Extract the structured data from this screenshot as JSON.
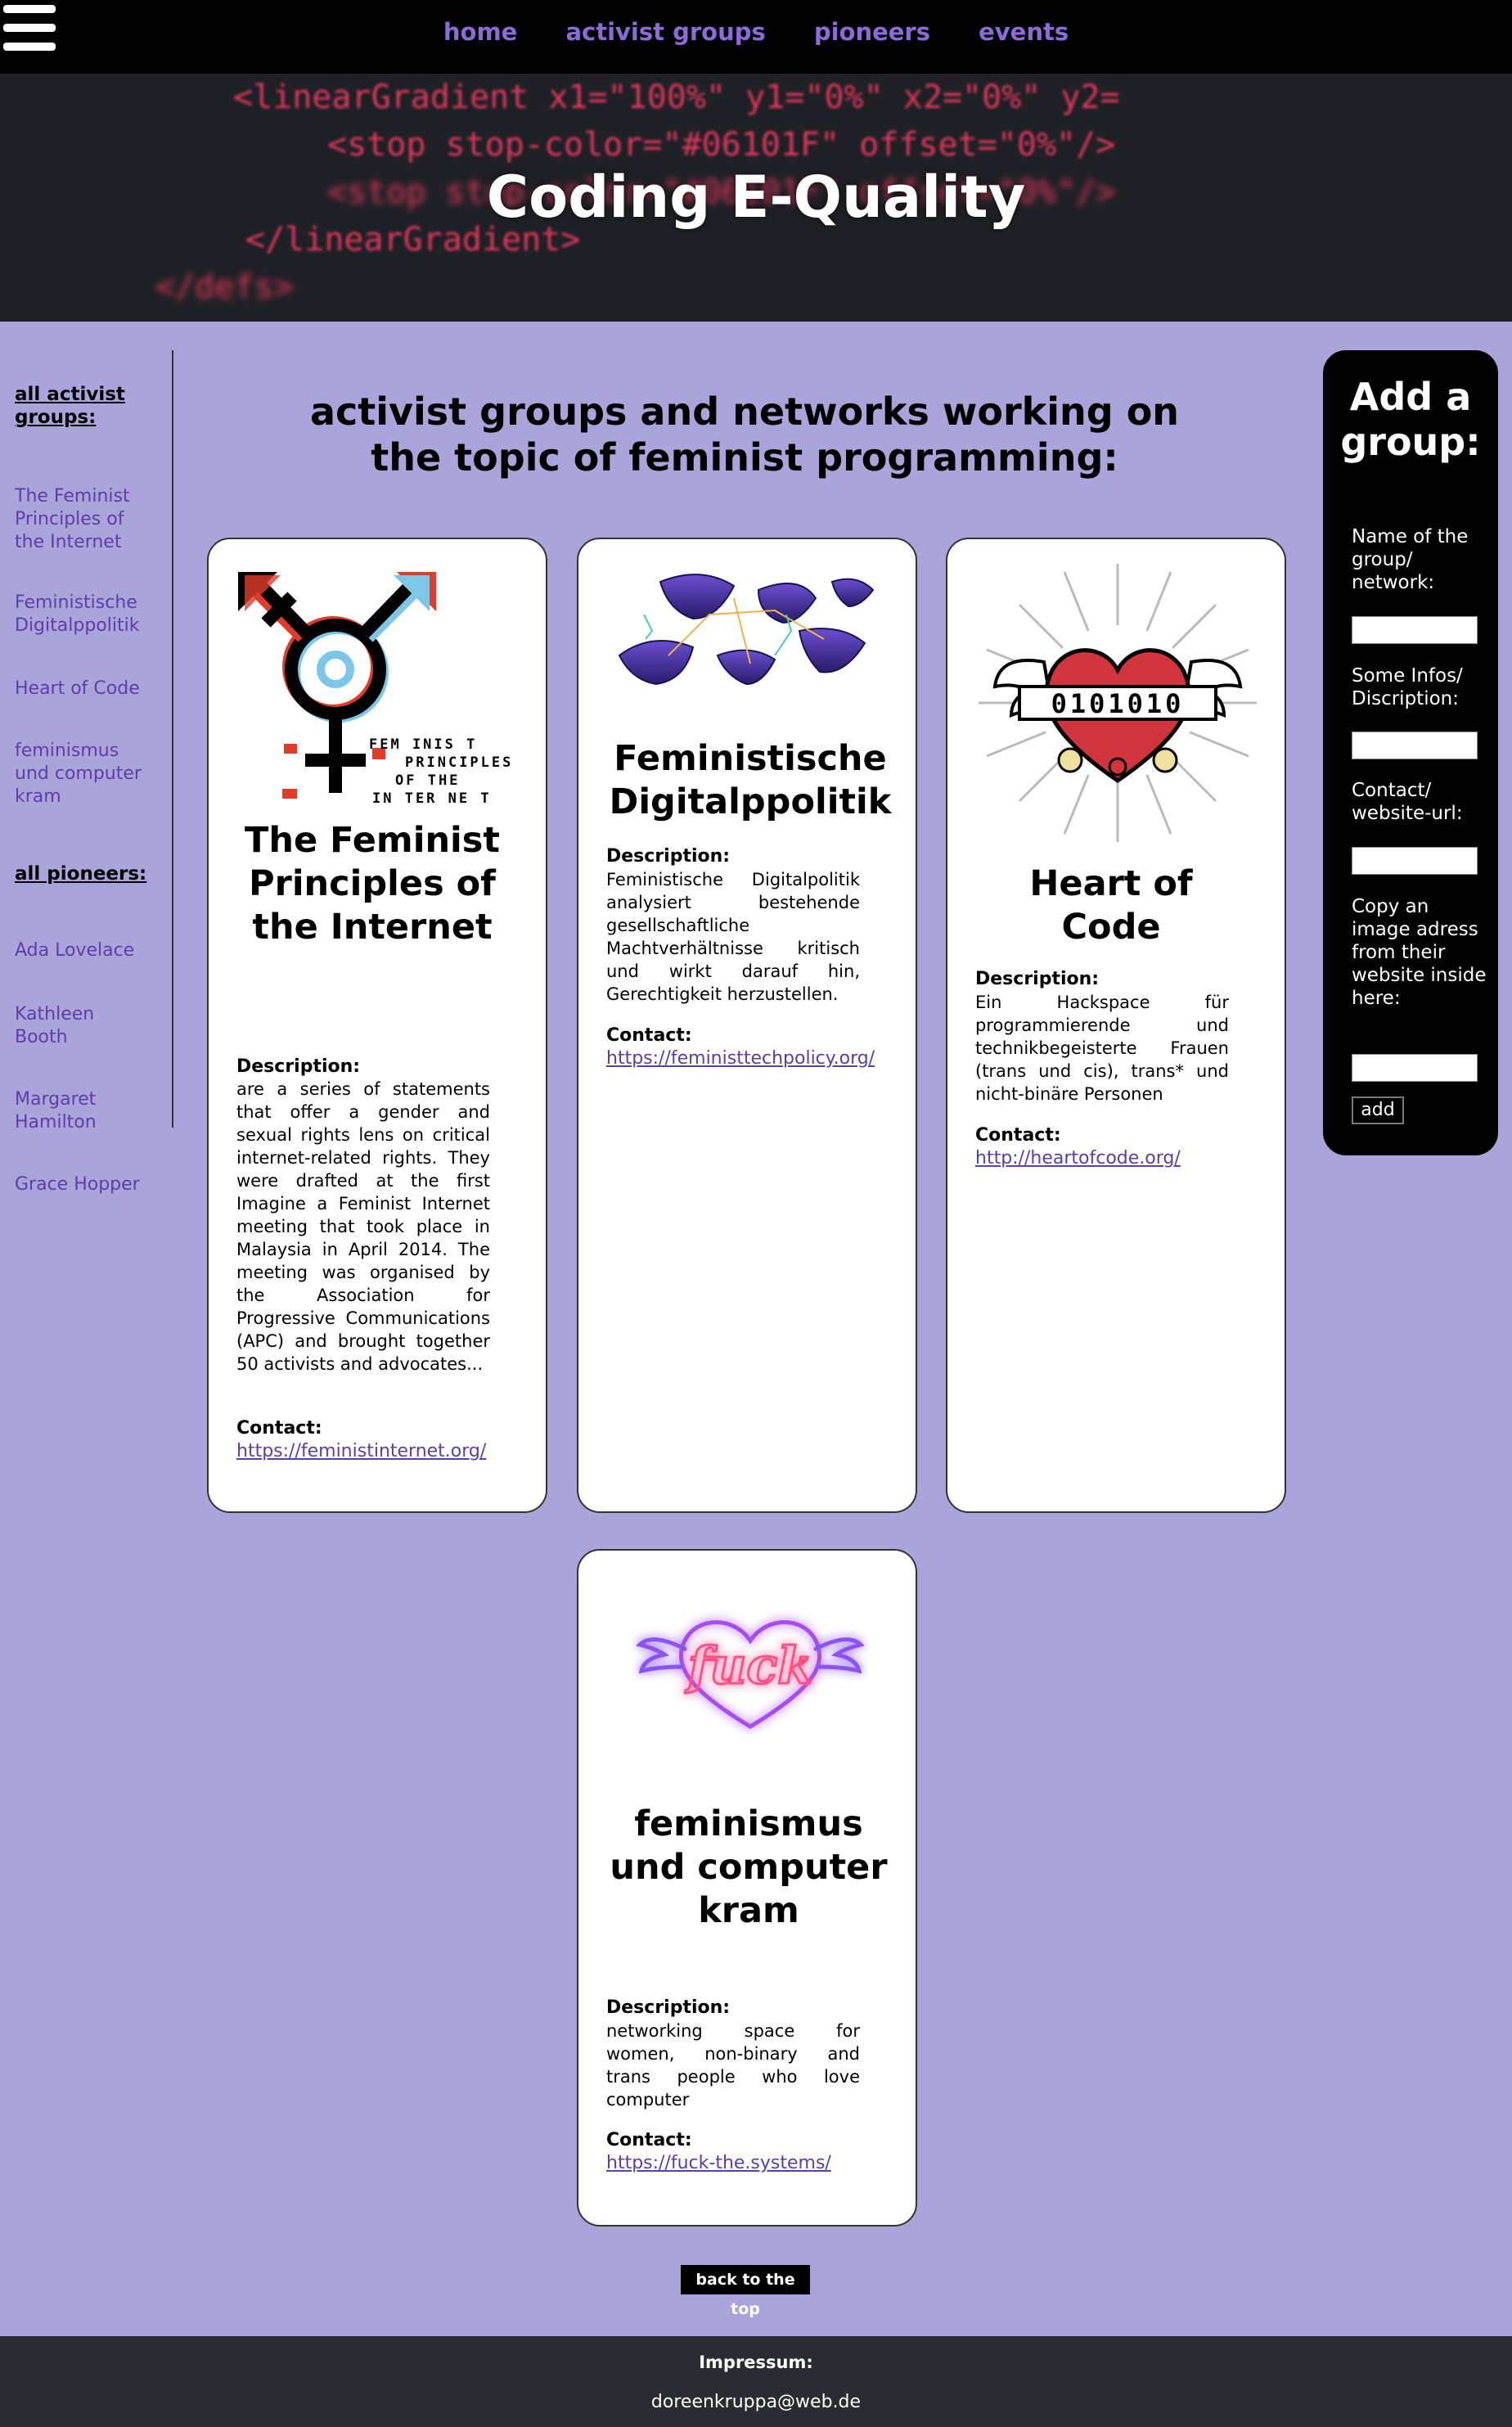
{
  "nav": {
    "links": [
      "home",
      "activist groups",
      "pioneers",
      "events"
    ]
  },
  "hero": {
    "title": "Coding E-Quality",
    "code_lines": [
      "<linearGradient x1=\"100%\" y1=\"0%\" x2=\"0%\" y2=",
      "<stop stop-color=\"#06101F\" offset=\"0%\"/>",
      "<stop stop-color=\"#06101F\" offset=\"0%\"/>",
      "</linearGradient>",
      "</defs>"
    ]
  },
  "sidebar": {
    "groups_heading": "all activist groups:",
    "groups": [
      "The Feminist Principles of the Internet",
      "Feministische Digitalppolitik",
      "Heart of Code",
      "feminismus und computer kram"
    ],
    "pioneers_heading": "all pioneers:",
    "pioneers": [
      "Ada Lovelace",
      "Kathleen Booth",
      "Margaret Hamilton",
      "Grace Hopper"
    ]
  },
  "main": {
    "heading": "activist groups and networks working on the topic of feminist programming:",
    "desc_label": "Description:",
    "contact_label": "Contact:",
    "cards": [
      {
        "title": "The Feminist Principles of the Internet",
        "image_text": [
          "FEM INIS T",
          "PRINCIPLES",
          "OF THE",
          "IN TER NE T"
        ],
        "description": "are a series of statements that offer a gender and sexual rights lens on critical internet-related rights. They were drafted at the first Imagine a Feminist Internet meeting that took place in Malaysia in April 2014. The meeting was organised by the Association for Progressive Communications (APC) and brought together 50 activists and advocates...",
        "contact": "https://feministinternet.org/"
      },
      {
        "title": "Feministische Digitalppolitik",
        "description": "Feministische Digitalpolitik analysiert bestehende gesellschaftliche Machtverhältnisse kritisch und wirkt darauf hin, Gerechtigkeit herzustellen.",
        "contact": "https://feministtechpolicy.org/"
      },
      {
        "title": "Heart of Code",
        "image_text": "0101010",
        "description": "Ein Hackspace für programmierende und technikbegeisterte Frauen (trans und cis), trans* und nicht-binäre Personen",
        "contact": "http://heartofcode.org/"
      },
      {
        "title": "feminismus und computer kram",
        "image_text": "fuck",
        "description": "networking space for women, non-binary and trans people who love computer",
        "contact": "https://fuck-the.systems/"
      }
    ]
  },
  "form": {
    "heading": "Add a group:",
    "fields": [
      "Name of the group/ network:",
      "Some Infos/ Discription:",
      "Contact/ website-url:",
      "Copy an image adress from their website inside here:"
    ],
    "button": "add"
  },
  "back_to_top": "back to the top",
  "footer": {
    "title": "Impressum:",
    "email": "doreenkruppa@web.de"
  },
  "colors": {
    "page_bg": "#aba4da",
    "nav_link": "#8a6bd8",
    "link": "#5b3fa6"
  }
}
